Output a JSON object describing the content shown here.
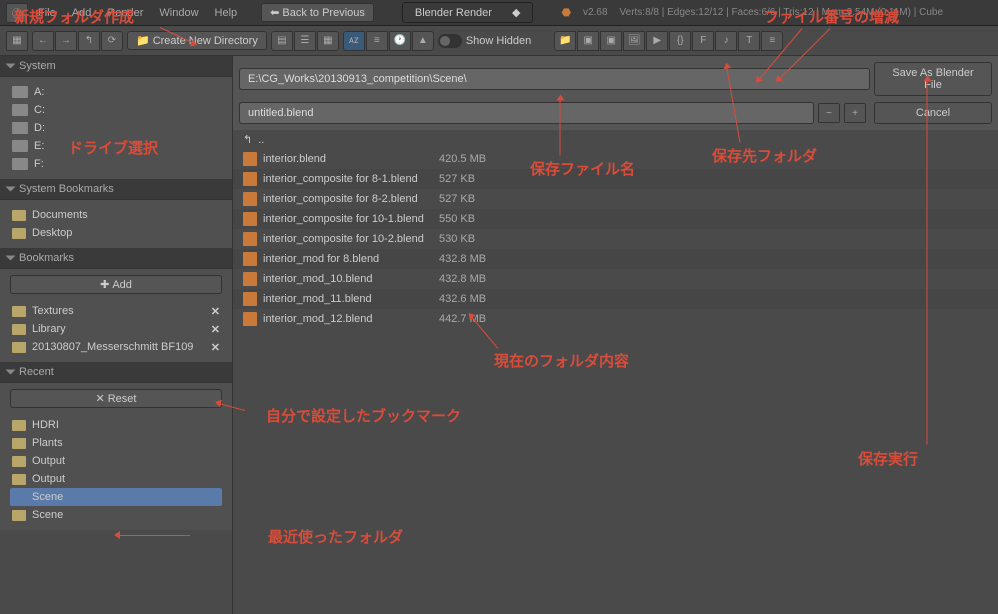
{
  "header": {
    "menu": [
      "File",
      "Add",
      "Render",
      "Window",
      "Help"
    ],
    "back": "Back to Previous",
    "render_engine": "Blender Render",
    "version": "v2.68",
    "stats": "Verts:8/8 | Edges:12/12 | Faces:6/6 | Tris:12 | Mem:9.54M (0.11M) | Cube"
  },
  "toolbar": {
    "create_dir": "Create New Directory",
    "show_hidden": "Show Hidden"
  },
  "path": "E:\\CG_Works\\20130913_competition\\Scene\\",
  "filename": "untitled.blend",
  "actions": {
    "save": "Save As Blender File",
    "cancel": "Cancel"
  },
  "sidebar": {
    "system": {
      "title": "System",
      "drives": [
        "A:",
        "C:",
        "D:",
        "E:",
        "F:"
      ]
    },
    "sys_bookmarks": {
      "title": "System Bookmarks",
      "items": [
        "Documents",
        "Desktop"
      ]
    },
    "bookmarks": {
      "title": "Bookmarks",
      "add": "Add",
      "items": [
        "Textures",
        "Library",
        "20130807_Messerschmitt BF109"
      ]
    },
    "recent": {
      "title": "Recent",
      "reset": "Reset",
      "items": [
        "HDRI",
        "Plants",
        "Output",
        "Output",
        "Scene",
        "Scene"
      ]
    }
  },
  "files": {
    "parent": "..",
    "list": [
      {
        "name": "interior.blend",
        "size": "420.5 MB"
      },
      {
        "name": "interior_composite for 8-1.blend",
        "size": "527 KB"
      },
      {
        "name": "interior_composite for 8-2.blend",
        "size": "527 KB"
      },
      {
        "name": "interior_composite for 10-1.blend",
        "size": "550 KB"
      },
      {
        "name": "interior_composite for 10-2.blend",
        "size": "530 KB"
      },
      {
        "name": "interior_mod for 8.blend",
        "size": "432.8 MB"
      },
      {
        "name": "interior_mod_10.blend",
        "size": "432.8 MB"
      },
      {
        "name": "interior_mod_11.blend",
        "size": "432.6 MB"
      },
      {
        "name": "interior_mod_12.blend",
        "size": "442.7 MB"
      }
    ]
  },
  "annotations": {
    "new_folder": "新規フォルダ作成",
    "drive_sel": "ドライブ選択",
    "file_number": "ファイル番号の増減",
    "save_name": "保存ファイル名",
    "save_folder": "保存先フォルダ",
    "folder_content": "現在のフォルダ内容",
    "bookmark_set": "自分で設定したブックマーク",
    "save_exec": "保存実行",
    "recent_folder": "最近使ったフォルダ"
  }
}
